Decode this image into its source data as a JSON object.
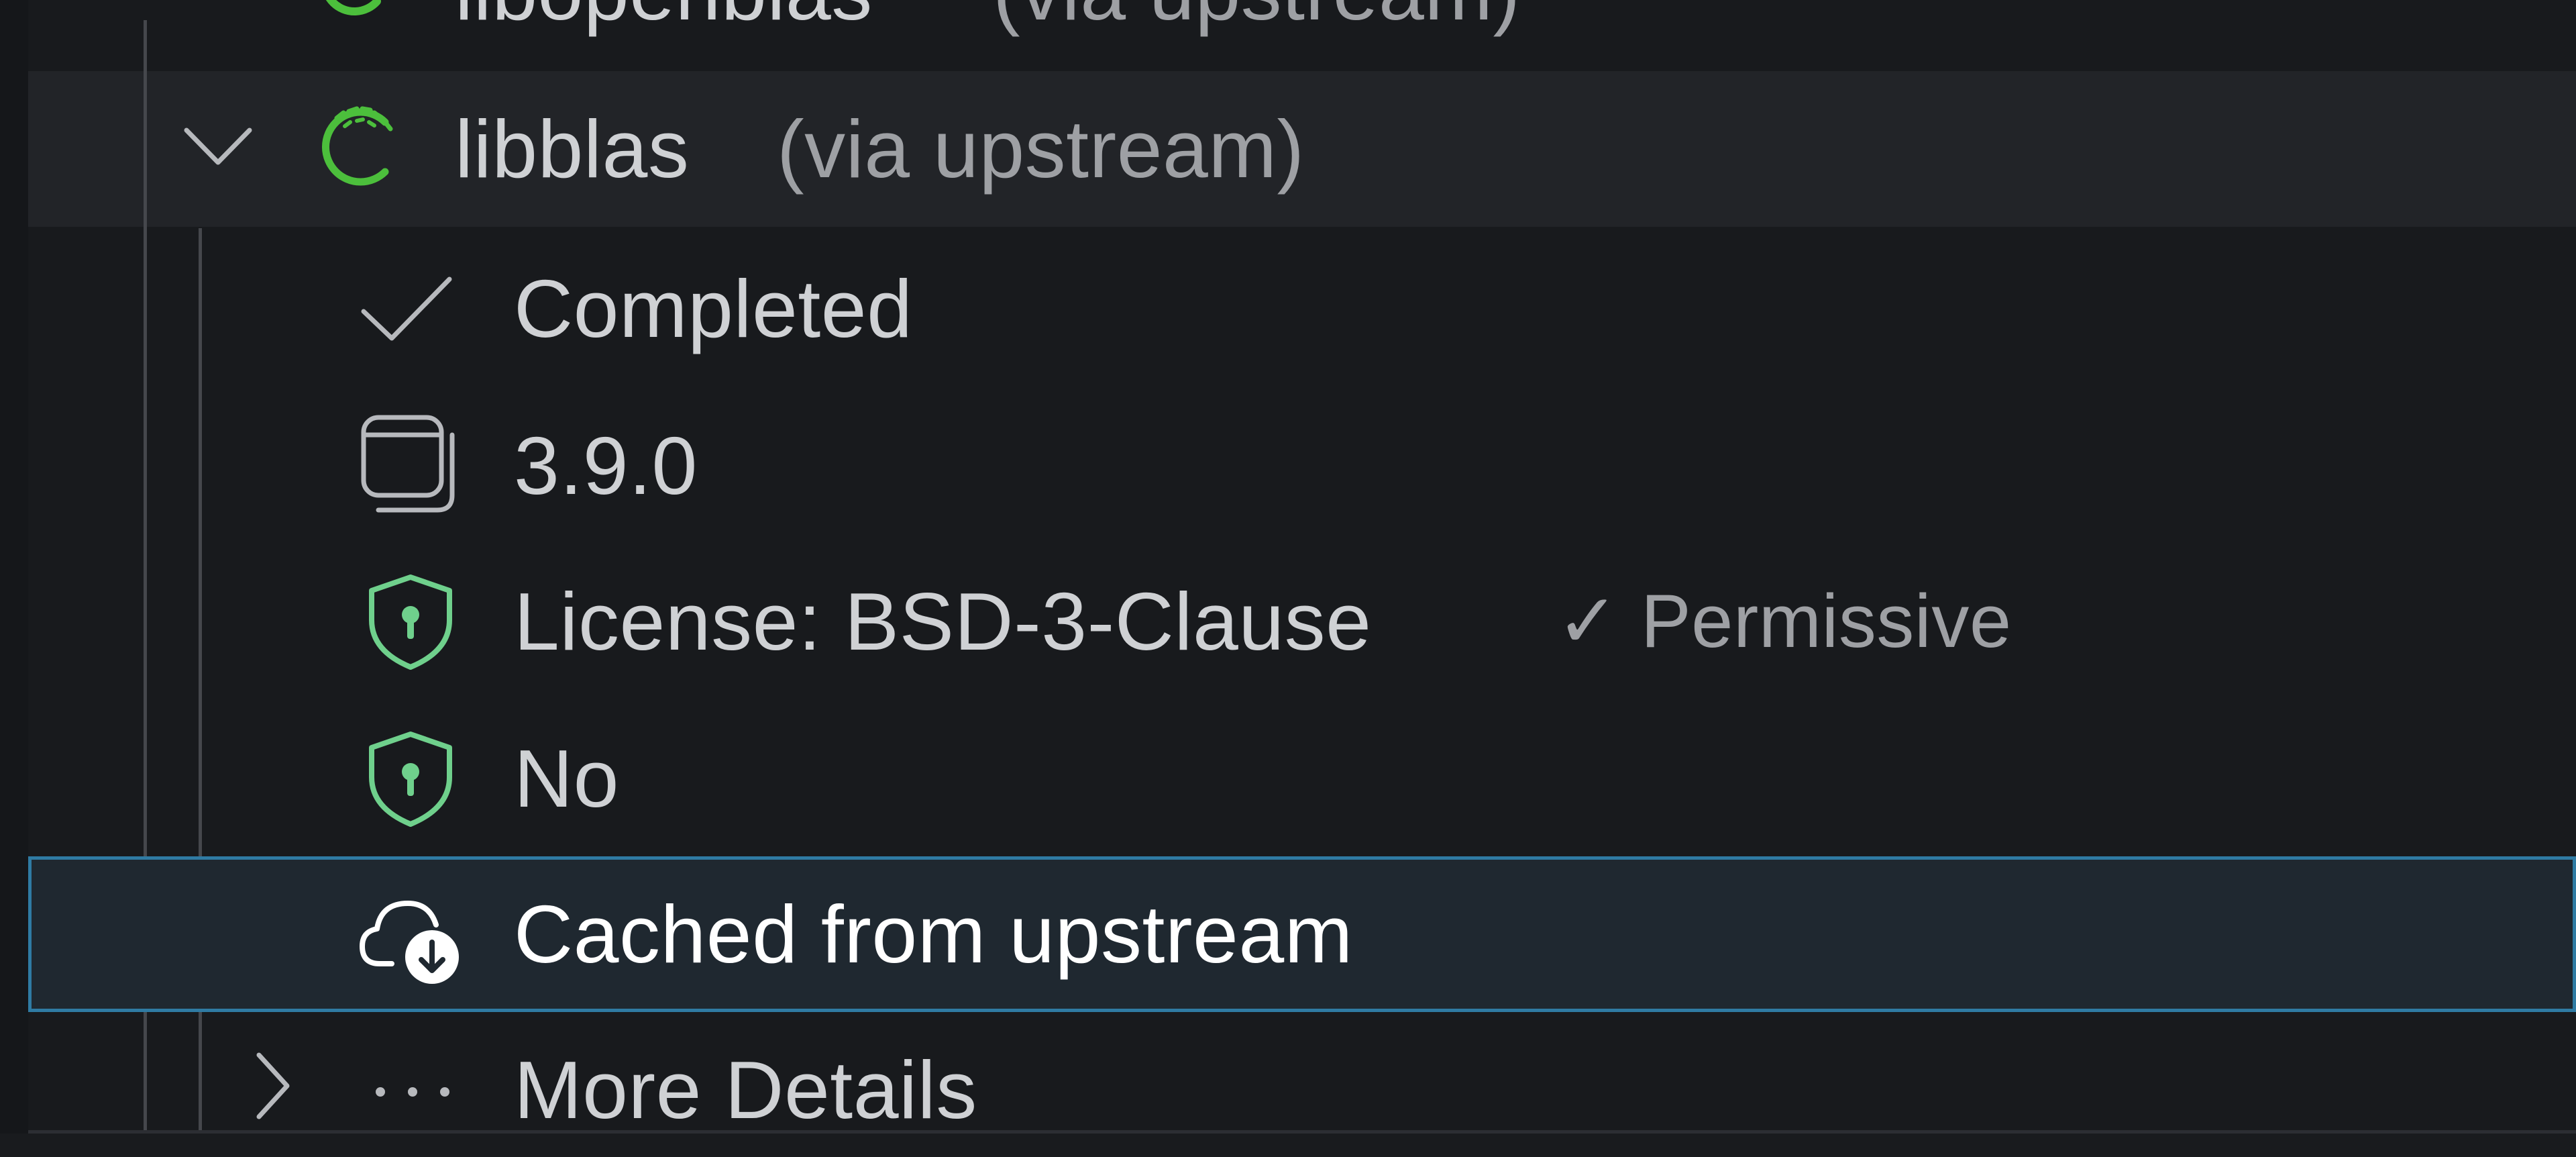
{
  "tree": {
    "previous_item": {
      "name": "libopenblas",
      "source": "(via upstream)"
    },
    "package": {
      "name": "libblas",
      "source": "(via upstream)",
      "expanded": true,
      "icon": "conda-forge-logo-icon",
      "icon_color": "#4cbf3c"
    },
    "details": [
      {
        "id": "status",
        "icon": "checkmark-icon",
        "label": "Completed"
      },
      {
        "id": "version",
        "icon": "versions-icon",
        "label": "3.9.0"
      },
      {
        "id": "license",
        "icon": "shield-icon",
        "label": "License: BSD-3-Clause",
        "note": "✓ Permissive"
      },
      {
        "id": "security",
        "icon": "shield-icon",
        "label": "No"
      },
      {
        "id": "cache",
        "icon": "cloud-download-icon",
        "label": "Cached from upstream",
        "selected": true
      },
      {
        "id": "more",
        "icon": "ellipsis-icon",
        "label": "More Details",
        "expanded": false
      }
    ]
  },
  "colors": {
    "background": "#181a1d",
    "selection_border": "#2f7ba3",
    "selection_fill": "#1f2830",
    "shield": "#6fd08c",
    "text": "#cfd1d4",
    "muted_text": "#9ea0a4"
  }
}
